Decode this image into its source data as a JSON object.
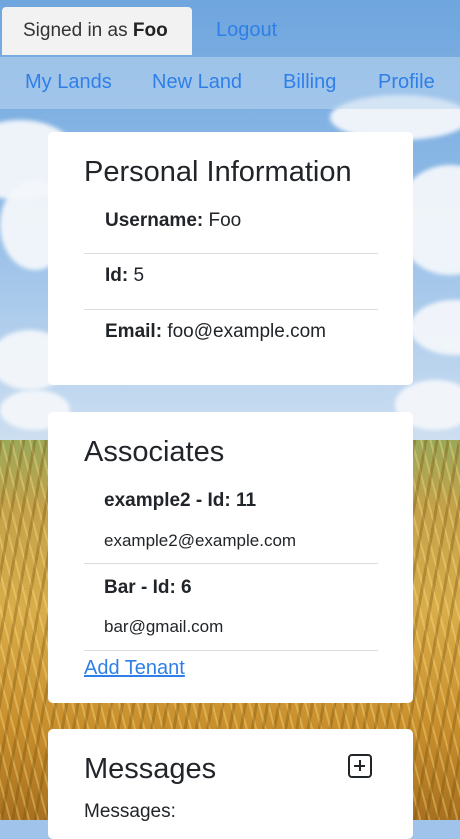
{
  "header": {
    "signed_in_prefix": "Signed in as",
    "username": "Foo",
    "logout_label": "Logout"
  },
  "nav": {
    "items": [
      {
        "label": "My Lands"
      },
      {
        "label": "New Land"
      },
      {
        "label": "Billing"
      },
      {
        "label": "Profile"
      }
    ]
  },
  "personal_info": {
    "title": "Personal Information",
    "fields": [
      {
        "label": "Username:",
        "value": "Foo"
      },
      {
        "label": "Id:",
        "value": "5"
      },
      {
        "label": "Email:",
        "value": "foo@example.com"
      }
    ]
  },
  "associates": {
    "title": "Associates",
    "items": [
      {
        "name": "example2 - Id: 11",
        "email": "example2@example.com"
      },
      {
        "name": "Bar - Id: 6",
        "email": "bar@gmail.com"
      }
    ],
    "add_label": "Add Tenant"
  },
  "messages": {
    "title": "Messages",
    "body_label": "Messages:",
    "add_icon": "plus-square-icon"
  }
}
